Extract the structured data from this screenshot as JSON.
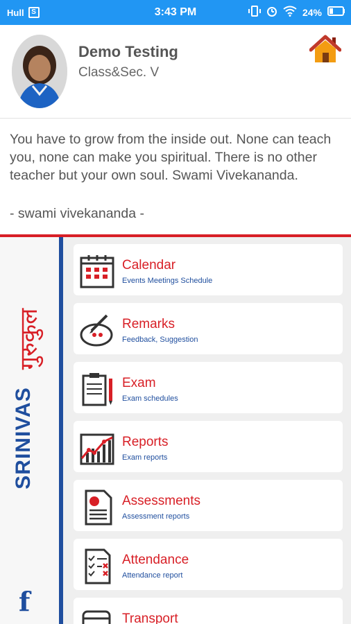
{
  "status_bar": {
    "time": "3:43 PM",
    "battery": "24%",
    "network_label": "Hull",
    "sim_label": "S"
  },
  "profile": {
    "name": "Demo Testing",
    "class_section": "Class&Sec. V"
  },
  "quote": {
    "text": "You have to grow from the inside out. None can teach you, none can make you spiritual. There is no other teacher but your own soul. Swami Vivekananda.",
    "author": "- swami vivekananda -"
  },
  "branding": {
    "english": "SRINIVAS",
    "hindi": "गुरुकुल",
    "facebook": "f"
  },
  "menu": [
    {
      "title": "Calendar",
      "subtitle": "Events Meetings Schedule",
      "icon": "calendar-icon"
    },
    {
      "title": "Remarks",
      "subtitle": "Feedback, Suggestion",
      "icon": "remarks-icon"
    },
    {
      "title": "Exam",
      "subtitle": "Exam schedules",
      "icon": "exam-icon"
    },
    {
      "title": "Reports",
      "subtitle": "Exam reports",
      "icon": "reports-icon"
    },
    {
      "title": "Assessments",
      "subtitle": "Assessment reports",
      "icon": "assessments-icon"
    },
    {
      "title": "Attendance",
      "subtitle": "Attendance report",
      "icon": "attendance-icon"
    },
    {
      "title": "Transport",
      "subtitle": "",
      "icon": "transport-icon"
    }
  ],
  "colors": {
    "status_bar": "#2196f3",
    "accent_red": "#d81f26",
    "brand_blue": "#1f4e9e"
  }
}
